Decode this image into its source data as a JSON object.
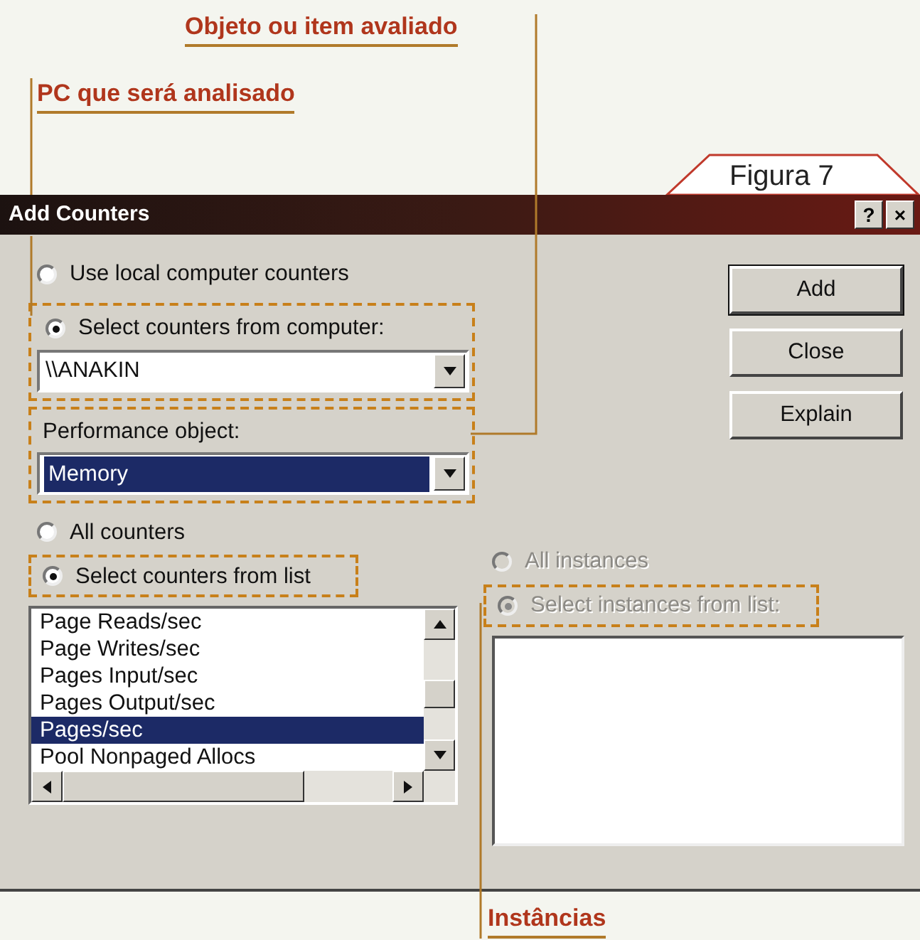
{
  "annotations": [
    {
      "text": "Objeto ou item avaliado"
    },
    {
      "text": "PC que será analisado"
    },
    {
      "text": "Instâncias"
    }
  ],
  "figure_label": "Figura 7",
  "window": {
    "title": "Add Counters",
    "buttons": [
      "?",
      "×"
    ]
  },
  "computer_source": [
    {
      "label": "Use local computer counters",
      "selected": false
    },
    {
      "label": "Select counters from computer:",
      "selected": true
    }
  ],
  "computer_field": {
    "value": "\\\\ANAKIN"
  },
  "performance_object": {
    "label": "Performance object:",
    "value": "Memory",
    "focused": true
  },
  "counter_mode": [
    {
      "label": "All counters",
      "selected": false
    },
    {
      "label": "Select counters from list",
      "selected": true
    }
  ],
  "counters": [
    {
      "text": "Page Reads/sec",
      "selected": false
    },
    {
      "text": "Page Writes/sec",
      "selected": false
    },
    {
      "text": "Pages Input/sec",
      "selected": false
    },
    {
      "text": "Pages Output/sec",
      "selected": false
    },
    {
      "text": "Pages/sec",
      "selected": true
    },
    {
      "text": "Pool Nonpaged Allocs",
      "selected": false
    }
  ],
  "instance_mode": [
    {
      "label": "All instances",
      "selected": false,
      "disabled": true
    },
    {
      "label": "Select instances from list:",
      "selected": true,
      "disabled": true
    }
  ],
  "buttons": [
    {
      "label": "Add",
      "default": true
    },
    {
      "label": "Close",
      "default": false
    },
    {
      "label": "Explain",
      "default": false
    }
  ]
}
